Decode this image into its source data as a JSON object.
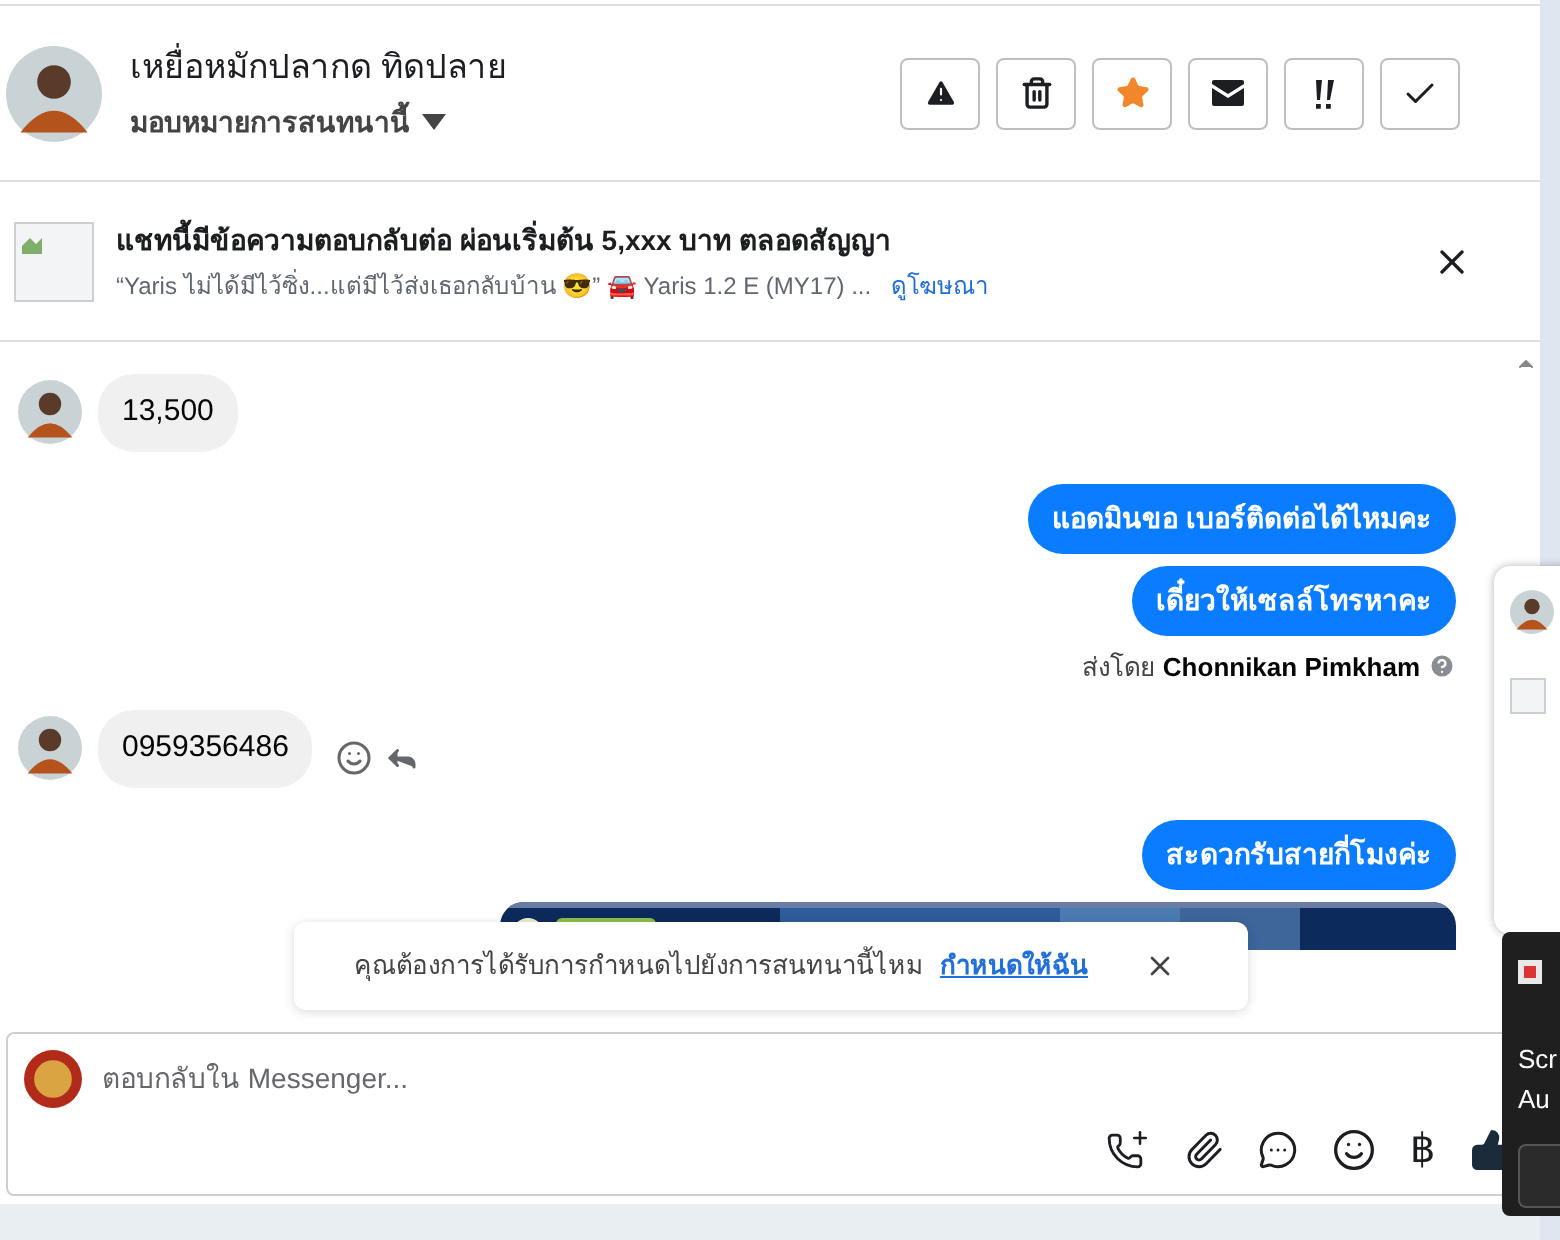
{
  "header": {
    "name": "เหยื่อหมักปลากด ทิดปลาย",
    "assign_label": "มอบหมายการสนทนานี้"
  },
  "actions": [
    {
      "kind": "alert",
      "on": false
    },
    {
      "kind": "trash",
      "on": false
    },
    {
      "kind": "star",
      "on": true
    },
    {
      "kind": "mail",
      "on": false
    },
    {
      "kind": "urgent",
      "on": false
    },
    {
      "kind": "done",
      "on": false
    }
  ],
  "ad": {
    "title": "แชทนี้มีข้อความตอบกลับต่อ ผ่อนเริ่มต้น 5,xxx บาท ตลอดสัญญา",
    "subtitle": "“Yaris ไม่ได้มีไว้ซิ่ง...แต่มีไว้ส่งเธอกลับบ้าน 😎” 🚘 Yaris 1.2 E (MY17) ...",
    "link": "ดูโฆษณา"
  },
  "messages": [
    {
      "kind": "incoming",
      "text": "13,500"
    },
    {
      "kind": "outgoing",
      "text": "แอดมินขอ เบอร์ติดต่อได้ไหมคะ"
    },
    {
      "kind": "outgoing",
      "text": "เดี๋ยวให้เซลล์โทรหาคะ"
    },
    {
      "kind": "sender",
      "prefix": "ส่งโดย",
      "name": "Chonnikan Pimkham"
    },
    {
      "kind": "incoming",
      "text": "0959356486",
      "actions": true
    },
    {
      "kind": "outgoing",
      "text": "สะดวกรับสายกี่โมงค่ะ"
    },
    {
      "kind": "picture"
    }
  ],
  "toast": {
    "text": "คุณต้องการได้รับการกำหนดไปยังการสนทนานี้ไหม",
    "link": "กำหนดให้ฉัน"
  },
  "composer": {
    "placeholder": "ตอบกลับใน Messenger...",
    "tools": [
      {
        "kind": "call"
      },
      {
        "kind": "attach"
      },
      {
        "kind": "chat"
      },
      {
        "kind": "emoji"
      },
      {
        "kind": "currency",
        "text": "฿"
      },
      {
        "kind": "like"
      }
    ]
  },
  "side_panel": {
    "lines": [
      "Scr",
      "Au"
    ]
  }
}
